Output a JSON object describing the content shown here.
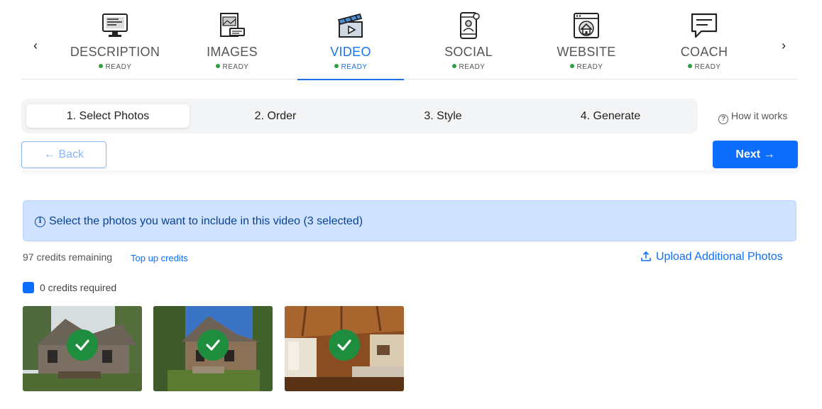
{
  "topnav": {
    "items": [
      {
        "label": "DESCRIPTION",
        "status": "READY",
        "icon": "monitor-icon"
      },
      {
        "label": "IMAGES",
        "status": "READY",
        "icon": "images-icon"
      },
      {
        "label": "VIDEO",
        "status": "READY",
        "icon": "clapperboard-icon"
      },
      {
        "label": "SOCIAL",
        "status": "READY",
        "icon": "smartphone-icon"
      },
      {
        "label": "WEBSITE",
        "status": "READY",
        "icon": "website-icon"
      },
      {
        "label": "COACH",
        "status": "READY",
        "icon": "chat-icon"
      }
    ],
    "prev": "‹",
    "next": "›"
  },
  "steps": [
    "1. Select Photos",
    "2. Order",
    "3. Style",
    "4. Generate"
  ],
  "how_it_works": "How it works",
  "back_label": "Back",
  "next_label": "Next",
  "info_text": "Select the photos you want to include in this video (3 selected)",
  "credits_remaining": "97 credits remaining",
  "top_up": "Top up credits",
  "upload_label": "Upload Additional Photos",
  "credits_required": "0 credits required",
  "colors": {
    "accent": "#0d6efd",
    "ready": "#2ea043",
    "check": "#1e8e3e"
  },
  "photos": [
    {
      "name": "stone-cottage-exterior",
      "selected": true
    },
    {
      "name": "cottage-front-steps",
      "selected": true
    },
    {
      "name": "wood-ceiling-living-room",
      "selected": true
    }
  ]
}
